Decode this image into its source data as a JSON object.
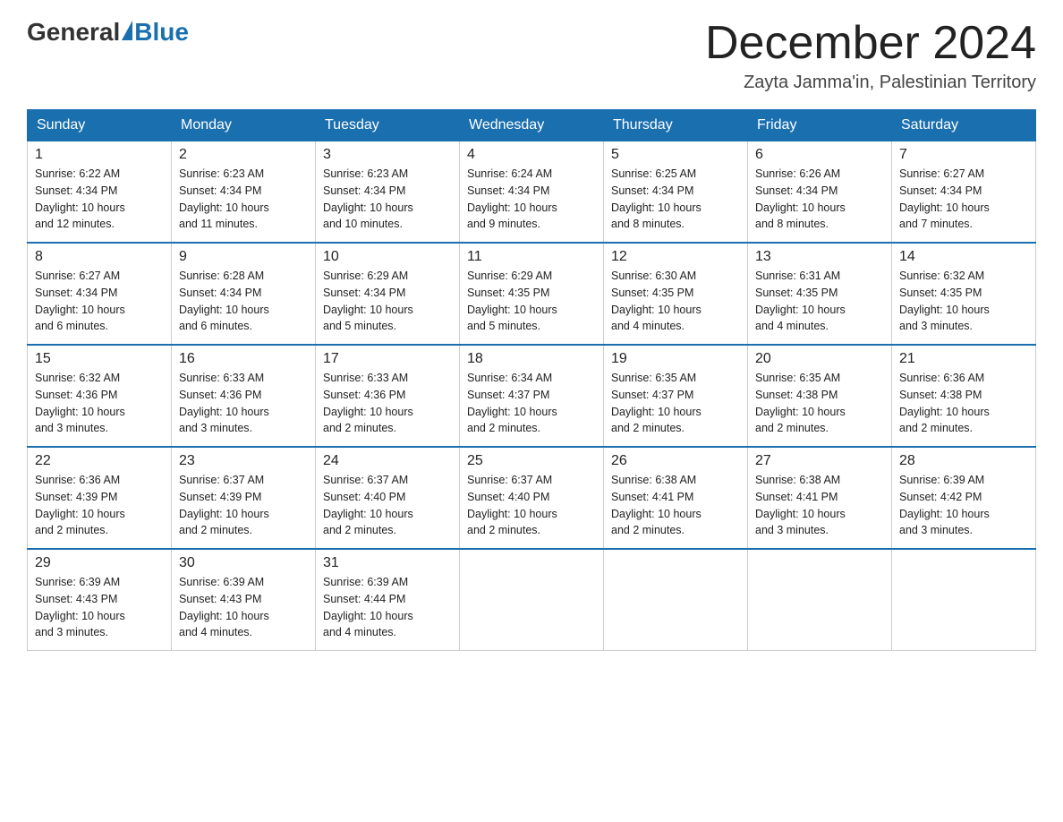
{
  "header": {
    "logo_text_general": "General",
    "logo_text_blue": "Blue",
    "month_title": "December 2024",
    "subtitle": "Zayta Jamma'in, Palestinian Territory"
  },
  "weekdays": [
    "Sunday",
    "Monday",
    "Tuesday",
    "Wednesday",
    "Thursday",
    "Friday",
    "Saturday"
  ],
  "weeks": [
    [
      {
        "day": "1",
        "sunrise": "6:22 AM",
        "sunset": "4:34 PM",
        "daylight": "10 hours and 12 minutes."
      },
      {
        "day": "2",
        "sunrise": "6:23 AM",
        "sunset": "4:34 PM",
        "daylight": "10 hours and 11 minutes."
      },
      {
        "day": "3",
        "sunrise": "6:23 AM",
        "sunset": "4:34 PM",
        "daylight": "10 hours and 10 minutes."
      },
      {
        "day": "4",
        "sunrise": "6:24 AM",
        "sunset": "4:34 PM",
        "daylight": "10 hours and 9 minutes."
      },
      {
        "day": "5",
        "sunrise": "6:25 AM",
        "sunset": "4:34 PM",
        "daylight": "10 hours and 8 minutes."
      },
      {
        "day": "6",
        "sunrise": "6:26 AM",
        "sunset": "4:34 PM",
        "daylight": "10 hours and 8 minutes."
      },
      {
        "day": "7",
        "sunrise": "6:27 AM",
        "sunset": "4:34 PM",
        "daylight": "10 hours and 7 minutes."
      }
    ],
    [
      {
        "day": "8",
        "sunrise": "6:27 AM",
        "sunset": "4:34 PM",
        "daylight": "10 hours and 6 minutes."
      },
      {
        "day": "9",
        "sunrise": "6:28 AM",
        "sunset": "4:34 PM",
        "daylight": "10 hours and 6 minutes."
      },
      {
        "day": "10",
        "sunrise": "6:29 AM",
        "sunset": "4:34 PM",
        "daylight": "10 hours and 5 minutes."
      },
      {
        "day": "11",
        "sunrise": "6:29 AM",
        "sunset": "4:35 PM",
        "daylight": "10 hours and 5 minutes."
      },
      {
        "day": "12",
        "sunrise": "6:30 AM",
        "sunset": "4:35 PM",
        "daylight": "10 hours and 4 minutes."
      },
      {
        "day": "13",
        "sunrise": "6:31 AM",
        "sunset": "4:35 PM",
        "daylight": "10 hours and 4 minutes."
      },
      {
        "day": "14",
        "sunrise": "6:32 AM",
        "sunset": "4:35 PM",
        "daylight": "10 hours and 3 minutes."
      }
    ],
    [
      {
        "day": "15",
        "sunrise": "6:32 AM",
        "sunset": "4:36 PM",
        "daylight": "10 hours and 3 minutes."
      },
      {
        "day": "16",
        "sunrise": "6:33 AM",
        "sunset": "4:36 PM",
        "daylight": "10 hours and 3 minutes."
      },
      {
        "day": "17",
        "sunrise": "6:33 AM",
        "sunset": "4:36 PM",
        "daylight": "10 hours and 2 minutes."
      },
      {
        "day": "18",
        "sunrise": "6:34 AM",
        "sunset": "4:37 PM",
        "daylight": "10 hours and 2 minutes."
      },
      {
        "day": "19",
        "sunrise": "6:35 AM",
        "sunset": "4:37 PM",
        "daylight": "10 hours and 2 minutes."
      },
      {
        "day": "20",
        "sunrise": "6:35 AM",
        "sunset": "4:38 PM",
        "daylight": "10 hours and 2 minutes."
      },
      {
        "day": "21",
        "sunrise": "6:36 AM",
        "sunset": "4:38 PM",
        "daylight": "10 hours and 2 minutes."
      }
    ],
    [
      {
        "day": "22",
        "sunrise": "6:36 AM",
        "sunset": "4:39 PM",
        "daylight": "10 hours and 2 minutes."
      },
      {
        "day": "23",
        "sunrise": "6:37 AM",
        "sunset": "4:39 PM",
        "daylight": "10 hours and 2 minutes."
      },
      {
        "day": "24",
        "sunrise": "6:37 AM",
        "sunset": "4:40 PM",
        "daylight": "10 hours and 2 minutes."
      },
      {
        "day": "25",
        "sunrise": "6:37 AM",
        "sunset": "4:40 PM",
        "daylight": "10 hours and 2 minutes."
      },
      {
        "day": "26",
        "sunrise": "6:38 AM",
        "sunset": "4:41 PM",
        "daylight": "10 hours and 2 minutes."
      },
      {
        "day": "27",
        "sunrise": "6:38 AM",
        "sunset": "4:41 PM",
        "daylight": "10 hours and 3 minutes."
      },
      {
        "day": "28",
        "sunrise": "6:39 AM",
        "sunset": "4:42 PM",
        "daylight": "10 hours and 3 minutes."
      }
    ],
    [
      {
        "day": "29",
        "sunrise": "6:39 AM",
        "sunset": "4:43 PM",
        "daylight": "10 hours and 3 minutes."
      },
      {
        "day": "30",
        "sunrise": "6:39 AM",
        "sunset": "4:43 PM",
        "daylight": "10 hours and 4 minutes."
      },
      {
        "day": "31",
        "sunrise": "6:39 AM",
        "sunset": "4:44 PM",
        "daylight": "10 hours and 4 minutes."
      },
      null,
      null,
      null,
      null
    ]
  ],
  "labels": {
    "sunrise": "Sunrise:",
    "sunset": "Sunset:",
    "daylight": "Daylight:"
  }
}
